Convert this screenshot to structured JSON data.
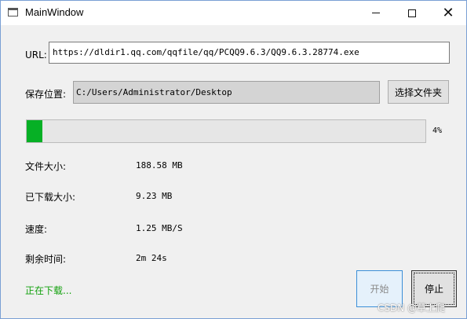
{
  "window": {
    "title": "MainWindow"
  },
  "titlebar": {
    "minimize": "─",
    "maximize": "☐",
    "close": "✕"
  },
  "url": {
    "label": "URL:",
    "value": "https://dldir1.qq.com/qqfile/qq/PCQQ9.6.3/QQ9.6.3.28774.exe"
  },
  "save": {
    "label": "保存位置:",
    "value": "C:/Users/Administrator/Desktop",
    "choose_folder_label": "选择文件夹"
  },
  "progress": {
    "value": 4,
    "text": "4%"
  },
  "info": {
    "file_size_label": "文件大小:",
    "file_size_value": "188.58 MB",
    "downloaded_label": "已下载大小:",
    "downloaded_value": "9.23 MB",
    "speed_label": "速度:",
    "speed_value": "1.25 MB/S",
    "remaining_label": "剩余时间:",
    "remaining_value": "2m 24s"
  },
  "status": {
    "text": "正在下载..."
  },
  "buttons": {
    "start_label": "开始",
    "stop_label": "停止"
  },
  "watermark": "CSDN @草上爬",
  "colors": {
    "progress_fill": "#06b025",
    "status_text": "#13a10e",
    "start_button_border": "#3c8fd8"
  },
  "icons": {
    "app": "window-icon"
  }
}
